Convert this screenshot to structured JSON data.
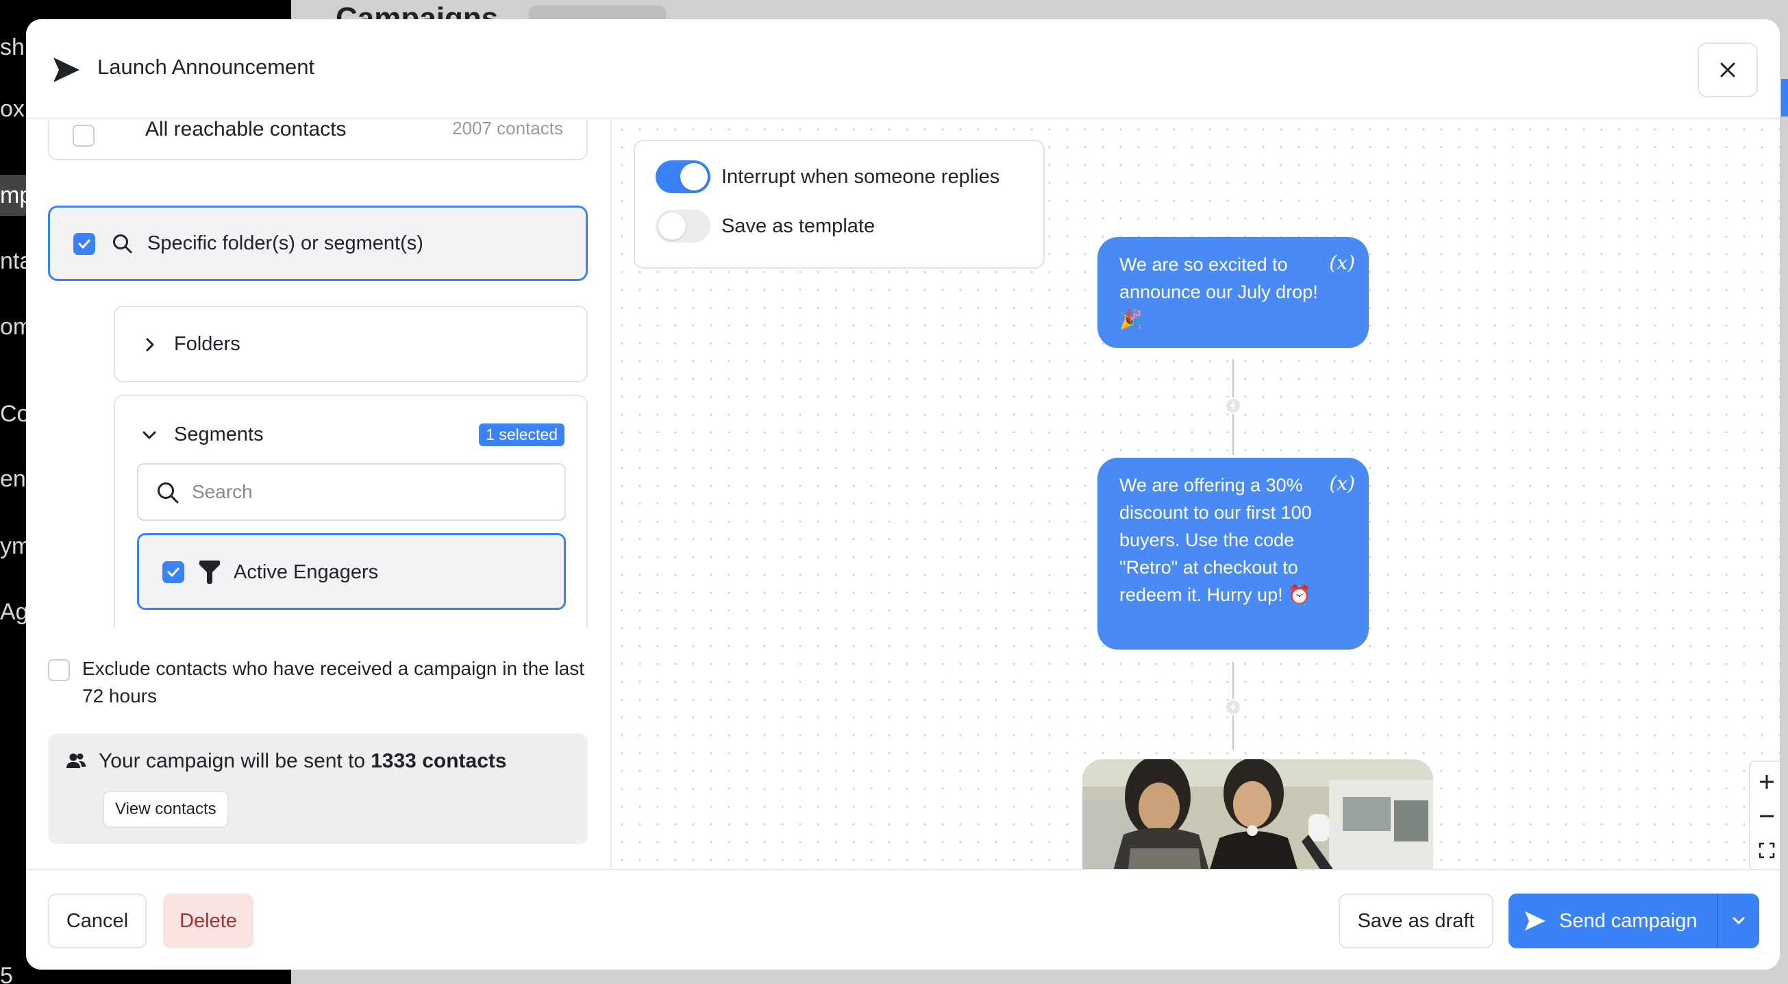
{
  "background": {
    "sidebar_items": [
      "shb",
      "ox",
      "mp",
      "nta",
      "om",
      "Cor",
      "ene",
      "yme",
      "Age",
      "5"
    ],
    "page_title": "Campaigns"
  },
  "modal": {
    "title": "Launch Announcement",
    "close_icon": "close-icon",
    "audience": {
      "all_contacts_label": "All reachable contacts",
      "all_contacts_count": "2007 contacts",
      "specific_label": "Specific folder(s) or segment(s)",
      "specific_checked": true,
      "folders_label": "Folders",
      "segments_label": "Segments",
      "segments_badge": "1 selected",
      "search_placeholder": "Search",
      "search_value": "",
      "segment_item_label": "Active Engagers",
      "segment_item_checked": true
    },
    "exclude": {
      "label": "Exclude contacts who have received a campaign in the last 72 hours",
      "checked": false
    },
    "summary": {
      "prefix": "Your campaign will be sent to",
      "count": "1333 contacts",
      "view_button": "View contacts"
    },
    "settings": {
      "interrupt_label": "Interrupt when someone replies",
      "interrupt_on": true,
      "template_label": "Save as template",
      "template_on": false
    },
    "flow": {
      "messages": [
        "We are so excited to announce our July drop! 🎉",
        "We are offering a 30% discount to our first 100 buyers. Use the code \"Retro\" at checkout to redeem it. Hurry up! ⏰"
      ],
      "variable_icon_text": "(x)"
    },
    "zoom": {
      "in": "+",
      "out": "−"
    },
    "footer": {
      "cancel": "Cancel",
      "delete": "Delete",
      "save_draft": "Save as draft",
      "send": "Send campaign"
    },
    "colors": {
      "accent": "#3b82f6",
      "bubble": "#4a8af4",
      "delete_bg": "#f9e3e3",
      "delete_text": "#a0302a"
    }
  }
}
